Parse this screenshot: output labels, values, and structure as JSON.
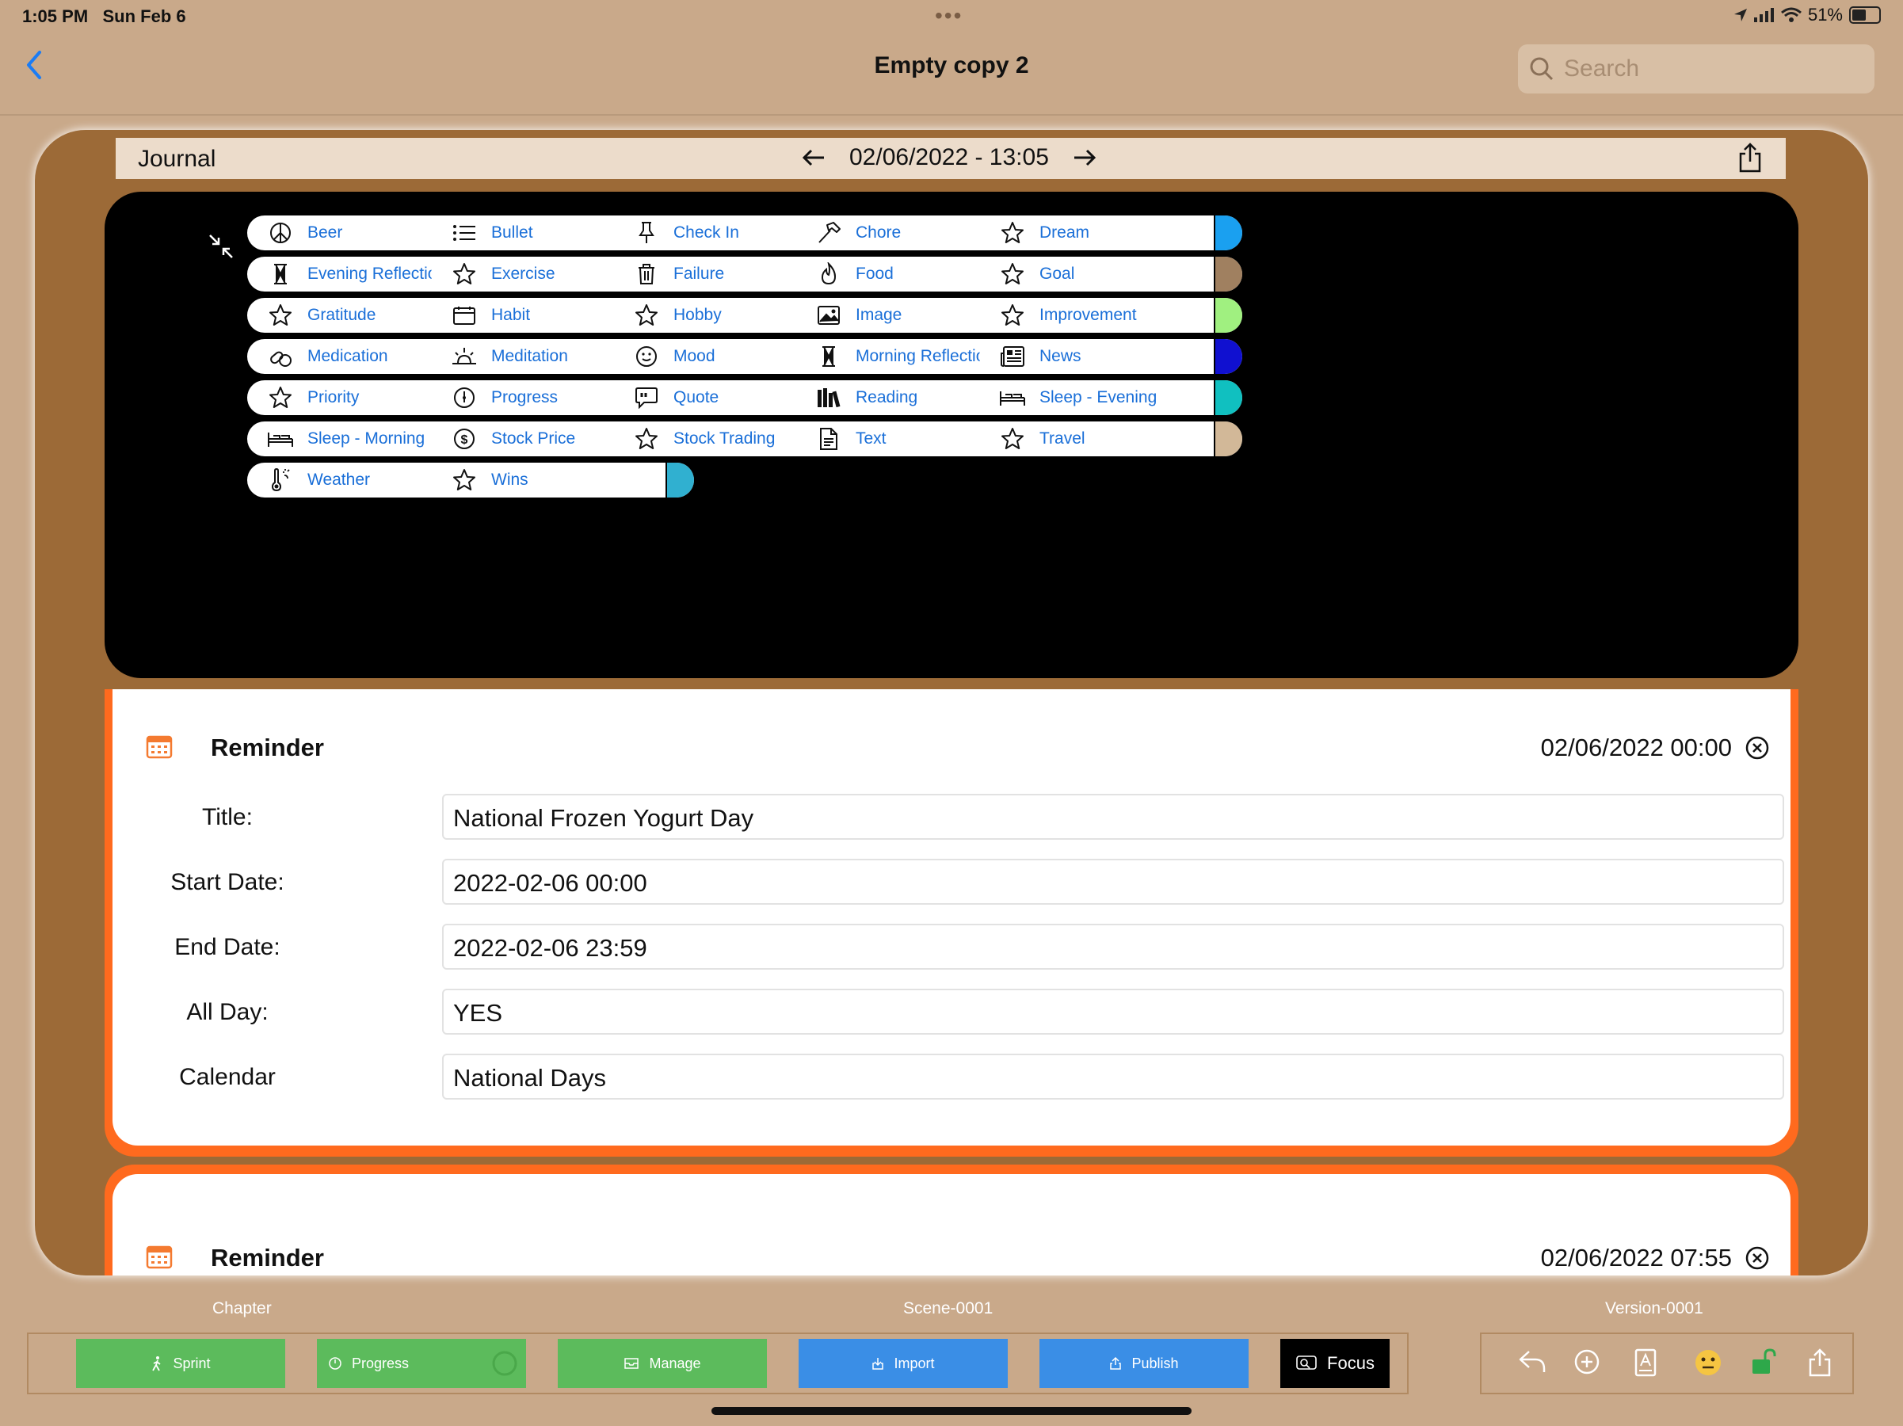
{
  "status": {
    "time": "1:05 PM",
    "date": "Sun Feb 6",
    "battery": "51%"
  },
  "nav": {
    "title": "Empty copy 2",
    "search_placeholder": "Search"
  },
  "journal": {
    "label": "Journal",
    "datetime": "02/06/2022 - 13:05"
  },
  "categories": [
    {
      "label": "Beer",
      "icon": "peace-icon",
      "color": "#c5141e"
    },
    {
      "label": "Bullet",
      "icon": "list-icon",
      "color": "#ffffff"
    },
    {
      "label": "Check In",
      "icon": "pin-icon",
      "color": "#1e6ff0"
    },
    {
      "label": "Chore",
      "icon": "hammer-icon",
      "color": "#b060e0"
    },
    {
      "label": "Dream",
      "icon": "star-icon",
      "color": "#1aa0f0"
    },
    {
      "label": "Evening Reflection",
      "icon": "hourglass-icon",
      "color": "#34a6e8"
    },
    {
      "label": "Exercise",
      "icon": "star-icon",
      "color": "#10c0c0"
    },
    {
      "label": "Failure",
      "icon": "trash-icon",
      "color": "#f2c812"
    },
    {
      "label": "Food",
      "icon": "flame-icon",
      "color": "#f79215"
    },
    {
      "label": "Goal",
      "icon": "star-icon",
      "color": "#a08060"
    },
    {
      "label": "Gratitude",
      "icon": "star-icon",
      "color": "#22b84a"
    },
    {
      "label": "Habit",
      "icon": "calendar-icon",
      "color": "#5ef0f0"
    },
    {
      "label": "Hobby",
      "icon": "star-icon",
      "color": "#f7a850"
    },
    {
      "label": "Image",
      "icon": "photo-icon",
      "color": "#000000"
    },
    {
      "label": "Improvement",
      "icon": "star-icon",
      "color": "#a0f080"
    },
    {
      "label": "Medication",
      "icon": "pills-icon",
      "color": "#d05050"
    },
    {
      "label": "Meditation",
      "icon": "sunrise-icon",
      "color": "#ecd8c4"
    },
    {
      "label": "Mood",
      "icon": "smiley-icon",
      "color": "#f02850"
    },
    {
      "label": "Morning Reflection",
      "icon": "hourglass-icon",
      "color": "#f03030"
    },
    {
      "label": "News",
      "icon": "newspaper-icon",
      "color": "#1010d0"
    },
    {
      "label": "Priority",
      "icon": "star-icon",
      "color": "#22b84a"
    },
    {
      "label": "Progress",
      "icon": "gauge-icon",
      "color": "#5a4fd0"
    },
    {
      "label": "Quote",
      "icon": "quote-icon",
      "color": "#e0d010"
    },
    {
      "label": "Reading",
      "icon": "books-icon",
      "color": "#10c820"
    },
    {
      "label": "Sleep - Evening",
      "icon": "bed-icon",
      "color": "#10c0c0"
    },
    {
      "label": "Sleep - Morning",
      "icon": "bed-icon",
      "color": "#8a8a8a"
    },
    {
      "label": "Stock Price",
      "icon": "dollar-icon",
      "color": "#b88c4c"
    },
    {
      "label": "Stock Trading",
      "icon": "star-icon",
      "color": "#6a3a10"
    },
    {
      "label": "Text",
      "icon": "document-icon",
      "color": "#8a68a8"
    },
    {
      "label": "Travel",
      "icon": "star-icon",
      "color": "#d2b898"
    },
    {
      "label": "Weather",
      "icon": "thermometer-icon",
      "color": "#a8b860"
    },
    {
      "label": "Wins",
      "icon": "star-icon",
      "color": "#30b0d0"
    }
  ],
  "reminder1": {
    "title": "Reminder",
    "date": "02/06/2022 00:00",
    "fields": [
      {
        "label": "Title:",
        "value": "National Frozen Yogurt Day"
      },
      {
        "label": "Start Date:",
        "value": "2022-02-06 00:00"
      },
      {
        "label": "End Date:",
        "value": "2022-02-06 23:59"
      },
      {
        "label": "All Day:",
        "value": "YES"
      },
      {
        "label": "Calendar",
        "value": "National Days"
      }
    ]
  },
  "reminder2": {
    "title": "Reminder",
    "date": "02/06/2022 07:55"
  },
  "footer": {
    "chapter": "Chapter",
    "scene": "Scene-0001",
    "version": "Version-0001",
    "buttons": {
      "sprint": "Sprint",
      "progress": "Progress",
      "manage": "Manage",
      "import": "Import",
      "publish": "Publish",
      "focus": "Focus"
    }
  }
}
